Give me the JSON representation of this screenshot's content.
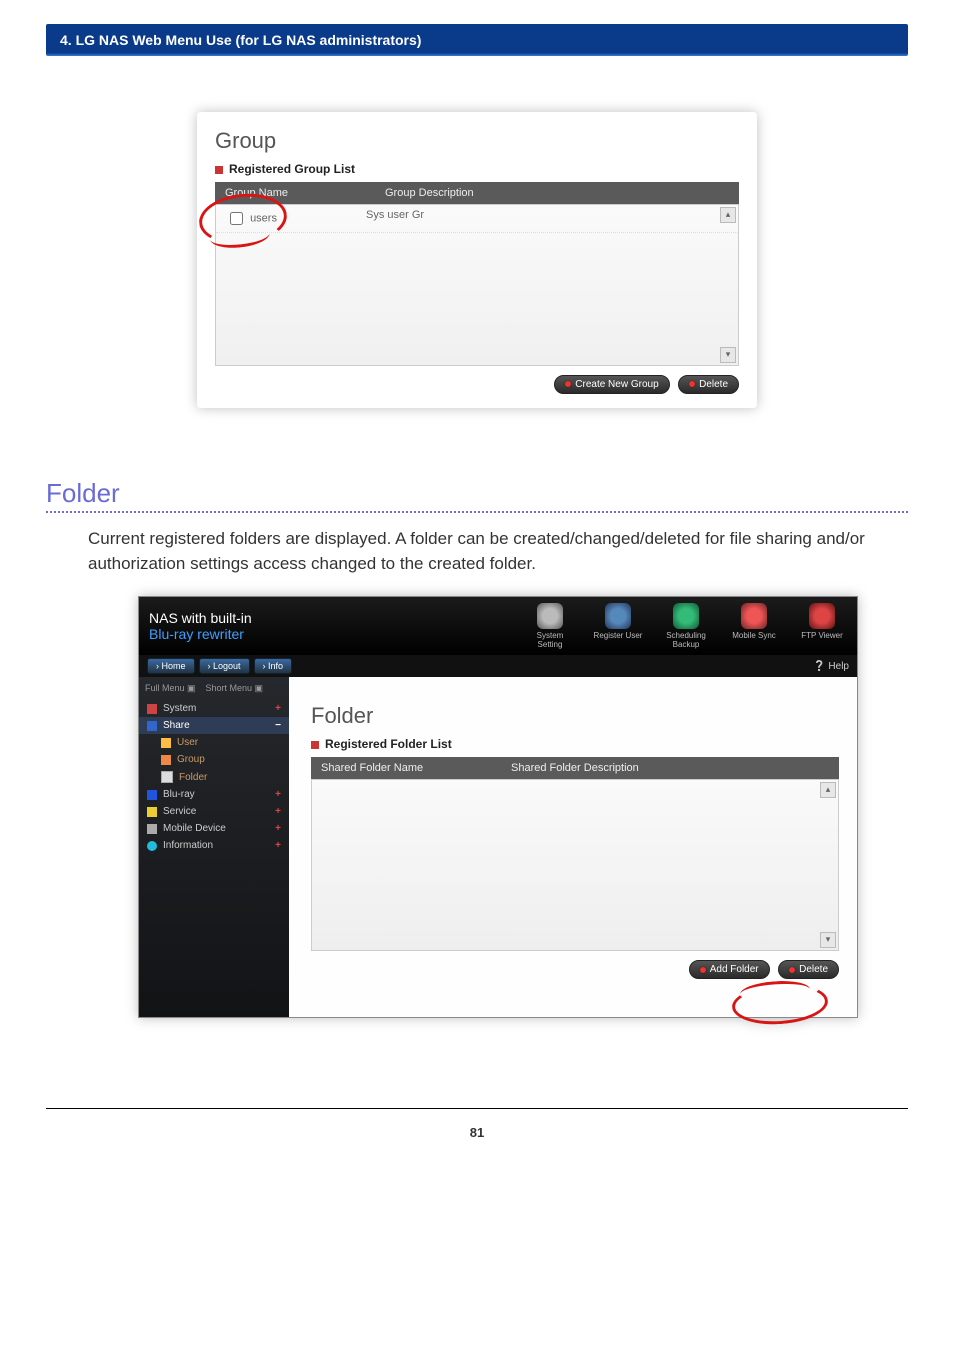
{
  "chapter_bar": "4. LG NAS Web Menu Use (for LG NAS administrators)",
  "group_panel": {
    "title": "Group",
    "subtitle": "Registered Group List",
    "headers": {
      "name": "Group Name",
      "desc": "Group Description"
    },
    "row": {
      "name": "users",
      "desc": "Sys user Gr"
    },
    "btn_create": "Create New Group",
    "btn_delete": "Delete"
  },
  "section": {
    "heading": "Folder",
    "para": "Current registered folders are displayed. A folder can be created/changed/deleted for file sharing and/or authorization settings access changed to the created folder."
  },
  "nas": {
    "brand_l1": "NAS with built-in",
    "brand_l2": "Blu-ray rewriter",
    "top_icons": {
      "sys": "System Setting",
      "usr": "Register User",
      "sch": "Scheduling Backup",
      "mob": "Mobile Sync",
      "ftp": "FTP Viewer"
    },
    "chips": {
      "home": "› Home",
      "logout": "› Logout",
      "info": "› Info"
    },
    "help": "Help",
    "side_tabs": {
      "full": "Full Menu ▣",
      "short": "Short Menu ▣"
    },
    "side": {
      "system": "System",
      "share": "Share",
      "user": "User",
      "group": "Group",
      "folder": "Folder",
      "bluray": "Blu-ray",
      "service": "Service",
      "mobile": "Mobile Device",
      "info": "Information"
    },
    "folder_panel": {
      "title": "Folder",
      "subtitle": "Registered Folder List",
      "headers": {
        "name": "Shared Folder Name",
        "desc": "Shared Folder Description"
      },
      "btn_add": "Add Folder",
      "btn_delete": "Delete"
    }
  },
  "page_number": "81"
}
